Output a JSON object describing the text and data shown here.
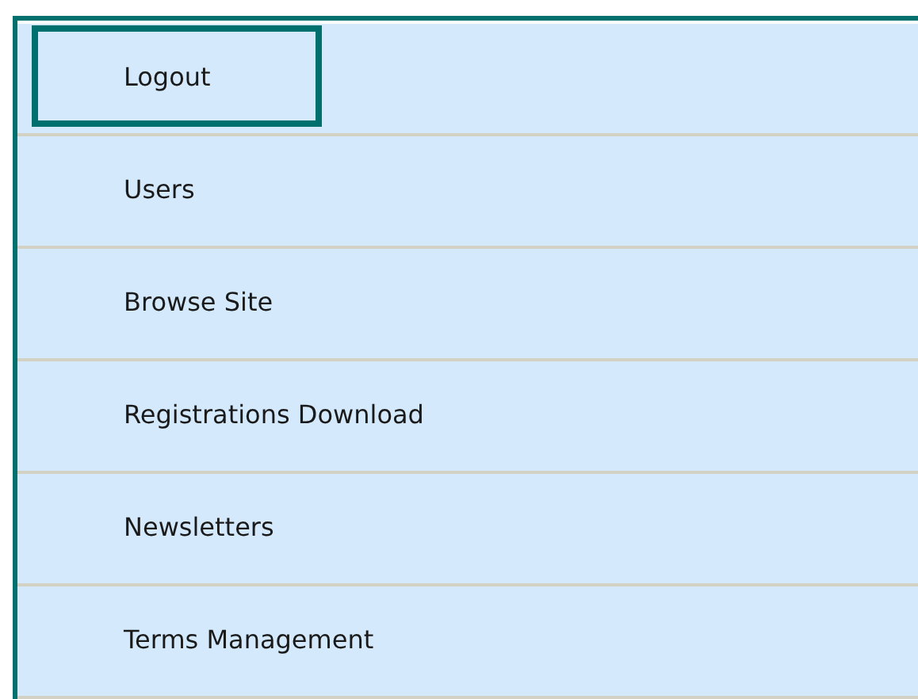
{
  "menu": {
    "items": [
      {
        "label": "Logout",
        "selected": true
      },
      {
        "label": "Users",
        "selected": false
      },
      {
        "label": "Browse Site",
        "selected": false
      },
      {
        "label": "Registrations Download",
        "selected": false
      },
      {
        "label": "Newsletters",
        "selected": false
      },
      {
        "label": "Terms Management",
        "selected": false
      }
    ]
  }
}
